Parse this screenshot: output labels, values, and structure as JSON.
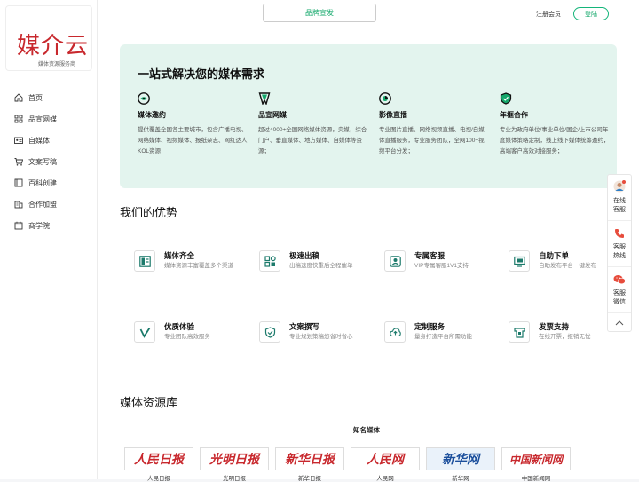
{
  "logo": {
    "text": "媒介云",
    "subtitle": "媒体资源服务商"
  },
  "sidebar": {
    "items": [
      {
        "label": "首页",
        "icon": "home-icon"
      },
      {
        "label": "品宣网媒",
        "icon": "grid-icon"
      },
      {
        "label": "自媒体",
        "icon": "id-card-icon"
      },
      {
        "label": "文案写稿",
        "icon": "cart-icon"
      },
      {
        "label": "百科创建",
        "icon": "book-icon"
      },
      {
        "label": "合作加盟",
        "icon": "building-icon"
      },
      {
        "label": "商学院",
        "icon": "calendar-icon"
      }
    ]
  },
  "header": {
    "brand_button": "品牌宣发",
    "register": "注册会员",
    "login": "登陆"
  },
  "hero": {
    "title": "一站式解决您的媒体需求",
    "features": [
      {
        "title": "媒体邀约",
        "desc": "提供覆盖全国各主要城市，包含广播电视、网络媒体、视频媒体、报纸杂志、网红达人KOL资源",
        "icon": "eye-icon"
      },
      {
        "title": "品宣网媒",
        "desc": "超过4000+全国网络媒体资源，央媒，综合门户、垂直媒体、地方媒体、自媒体等资源；",
        "icon": "ribbon-icon"
      },
      {
        "title": "影像直播",
        "desc": "专业图片直播、网络视频直播、电视/自媒体直播服务，专业服务团队，全网100+视频平台分发；",
        "icon": "camera-icon"
      },
      {
        "title": "年框合作",
        "desc": "专业为政府单位/事业单位/国企/上市公司年度媒体策略定制，线上线下媒体统筹邀约，高端客户高效对接服务；",
        "icon": "shield-check-icon"
      }
    ]
  },
  "advantages": {
    "title": "我们的优势",
    "items": [
      {
        "title": "媒体齐全",
        "desc": "媒体资源丰富覆盖多个渠道",
        "icon": "layout-icon"
      },
      {
        "title": "极速出稿",
        "desc": "出稿速度快重后全程催单",
        "icon": "apps-icon"
      },
      {
        "title": "专属客服",
        "desc": "VIP专属客服1V1支持",
        "icon": "user-icon"
      },
      {
        "title": "自助下单",
        "desc": "自助发布平台一键发布",
        "icon": "monitor-icon"
      },
      {
        "title": "优质体验",
        "desc": "专业团队高效服务",
        "icon": "check-icon"
      },
      {
        "title": "文案撰写",
        "desc": "专业规划策稿悠省时省心",
        "icon": "shield-icon"
      },
      {
        "title": "定制服务",
        "desc": "量身打造平台所需功能",
        "icon": "cloud-upload-icon"
      },
      {
        "title": "发票支持",
        "desc": "在线开票，报销无忧",
        "icon": "invoice-icon"
      }
    ]
  },
  "library": {
    "title": "媒体资源库",
    "section": "知名媒体",
    "medias": [
      {
        "logo": "人民日报",
        "name": "人民日报"
      },
      {
        "logo": "光明日报",
        "name": "光明日报"
      },
      {
        "logo": "新华日报",
        "name": "新华日报"
      },
      {
        "logo": "人民网",
        "name": "人民网"
      },
      {
        "logo": "新华网",
        "name": "新华网"
      },
      {
        "logo": "中国新闻网",
        "name": "中国新闻网"
      }
    ]
  },
  "float": {
    "items": [
      {
        "label": "在线客服",
        "icon": "avatar-icon"
      },
      {
        "label": "客服热线",
        "icon": "phone-icon"
      },
      {
        "label": "客服微信",
        "icon": "wechat-icon"
      }
    ]
  },
  "colors": {
    "accent": "#14a86b",
    "hero_bg": "#e3f4ee",
    "brand_red": "#c8282d"
  }
}
